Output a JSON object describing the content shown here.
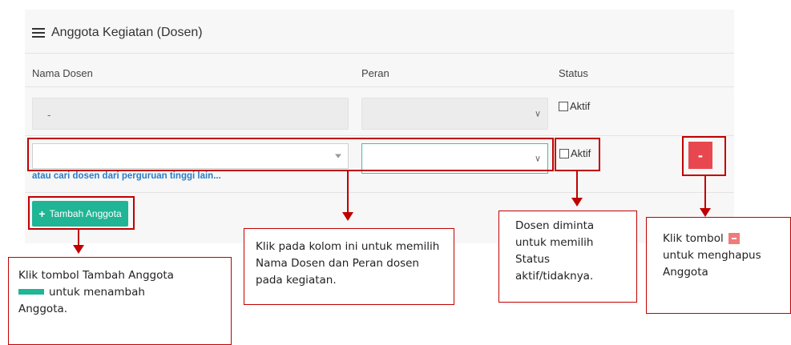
{
  "card": {
    "title": "Anggota Kegiatan (Dosen)",
    "columns": {
      "nama": "Nama Dosen",
      "peran": "Peran",
      "status": "Status"
    }
  },
  "rows": [
    {
      "nama_value": "-",
      "status_label": "Aktif"
    },
    {
      "status_label": "Aktif"
    }
  ],
  "link_text": "atau cari dosen dari perguruan tinggi lain...",
  "buttons": {
    "tambah": "Tambah Anggota",
    "hapus": "-"
  },
  "callouts": {
    "tambah": {
      "line1": "Klik tombol Tambah Anggota",
      "line2": "untuk menambah",
      "line3": "Anggota."
    },
    "kolom": "Klik pada kolom ini untuk memilih Nama Dosen dan Peran dosen pada kegiatan.",
    "status": "Dosen diminta untuk memilih Status aktif/tidaknya.",
    "hapus": {
      "line1": "Klik tombol",
      "line2": "untuk menghapus Anggota"
    }
  },
  "colors": {
    "accent_green": "#1fb595",
    "danger_red": "#e8474f",
    "annotation_red": "#c00000",
    "link_blue": "#2a7cc7"
  }
}
